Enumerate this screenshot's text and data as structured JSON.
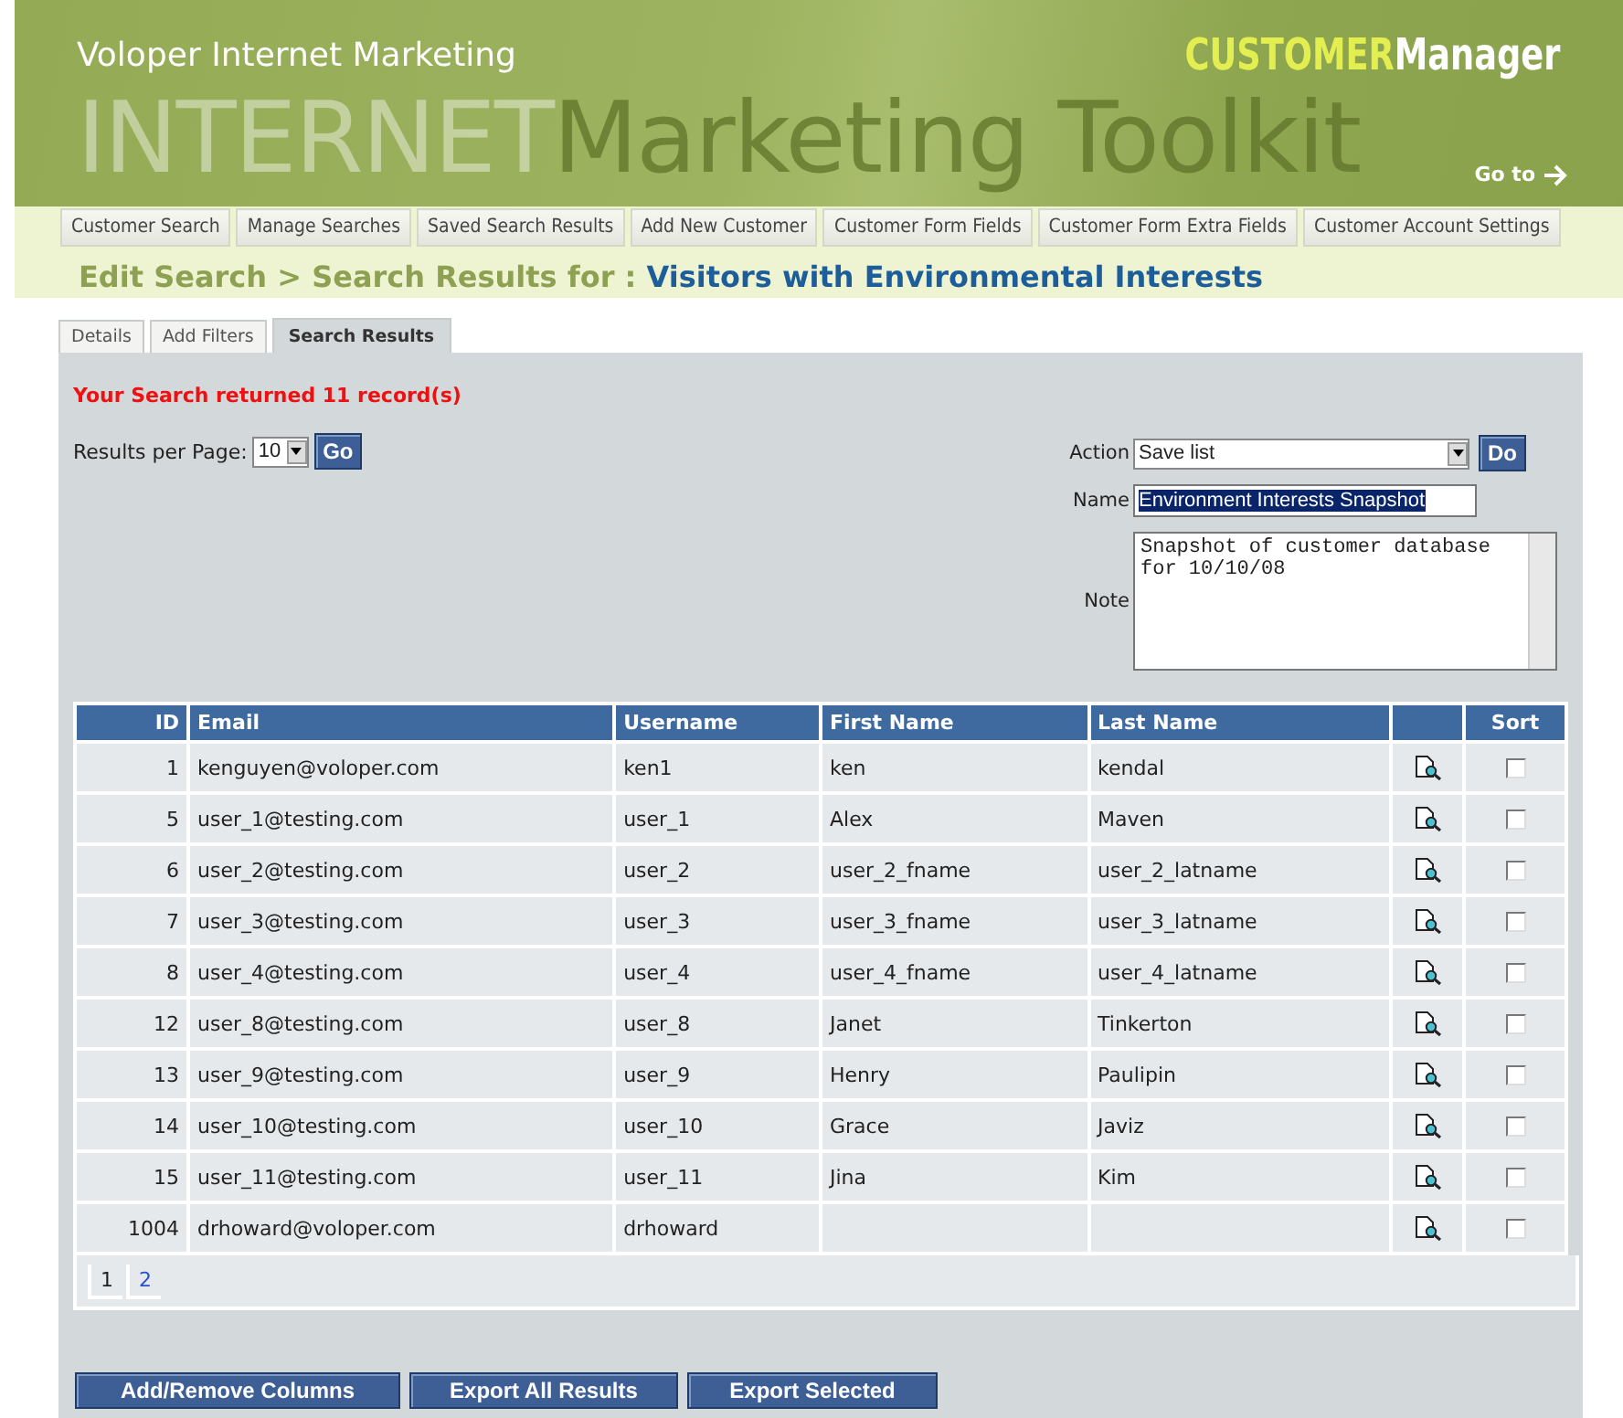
{
  "header": {
    "site_title": "Voloper Internet Marketing",
    "banner_text": [
      "INTERNET",
      "Marketing Toolkit"
    ],
    "product_name": [
      "CUSTOMER",
      "Manager"
    ],
    "goto_link": "Go to"
  },
  "nav": [
    {
      "label": "Customer Search"
    },
    {
      "label": "Manage Searches"
    },
    {
      "label": "Saved Search Results"
    },
    {
      "label": "Add New Customer"
    },
    {
      "label": "Customer Form Fields"
    },
    {
      "label": "Customer Form Extra Fields"
    },
    {
      "label": "Customer Account Settings"
    }
  ],
  "breadcrumb": {
    "path": "Edit Search > Search Results for :",
    "search_name": "Visitors with Environmental Interests"
  },
  "tabs": [
    {
      "label": "Details",
      "selected": false
    },
    {
      "label": "Add Filters",
      "selected": false
    },
    {
      "label": "Search Results",
      "selected": true
    }
  ],
  "result_message": "Your Search returned 11 record(s)",
  "results_per_page": {
    "label": "Results per Page:",
    "value": "10",
    "button": "Go"
  },
  "action_form": {
    "action_label": "Action",
    "action_value": "Save list",
    "action_button": "Do",
    "name_label": "Name",
    "name_value": "Environment Interests Snapshot",
    "note_label": "Note",
    "note_value": "Snapshot of customer database for 10/10/08"
  },
  "table": {
    "columns": [
      "ID",
      "Email",
      "Username",
      "First Name",
      "Last Name",
      "Sort"
    ],
    "rows": [
      {
        "id": "1",
        "email": "kenguyen@voloper.com",
        "username": "ken1",
        "first_name": "ken",
        "last_name": "kendal",
        "checked": false
      },
      {
        "id": "5",
        "email": "user_1@testing.com",
        "username": "user_1",
        "first_name": "Alex",
        "last_name": "Maven",
        "checked": false
      },
      {
        "id": "6",
        "email": "user_2@testing.com",
        "username": "user_2",
        "first_name": "user_2_fname",
        "last_name": "user_2_latname",
        "checked": false
      },
      {
        "id": "7",
        "email": "user_3@testing.com",
        "username": "user_3",
        "first_name": "user_3_fname",
        "last_name": "user_3_latname",
        "checked": false
      },
      {
        "id": "8",
        "email": "user_4@testing.com",
        "username": "user_4",
        "first_name": "user_4_fname",
        "last_name": "user_4_latname",
        "checked": false
      },
      {
        "id": "12",
        "email": "user_8@testing.com",
        "username": "user_8",
        "first_name": "Janet",
        "last_name": "Tinkerton",
        "checked": false
      },
      {
        "id": "13",
        "email": "user_9@testing.com",
        "username": "user_9",
        "first_name": "Henry",
        "last_name": "Paulipin",
        "checked": false
      },
      {
        "id": "14",
        "email": "user_10@testing.com",
        "username": "user_10",
        "first_name": "Grace",
        "last_name": "Javiz",
        "checked": false
      },
      {
        "id": "15",
        "email": "user_11@testing.com",
        "username": "user_11",
        "first_name": "Jina",
        "last_name": "Kim",
        "checked": false
      },
      {
        "id": "1004",
        "email": "drhoward@voloper.com",
        "username": "drhoward",
        "first_name": "",
        "last_name": "",
        "checked": false
      }
    ]
  },
  "pagination": [
    {
      "label": "1",
      "selected": true
    },
    {
      "label": "2",
      "selected": false
    }
  ],
  "buttons": [
    "Add/Remove Columns",
    "Export All Results",
    "Export Selected"
  ]
}
